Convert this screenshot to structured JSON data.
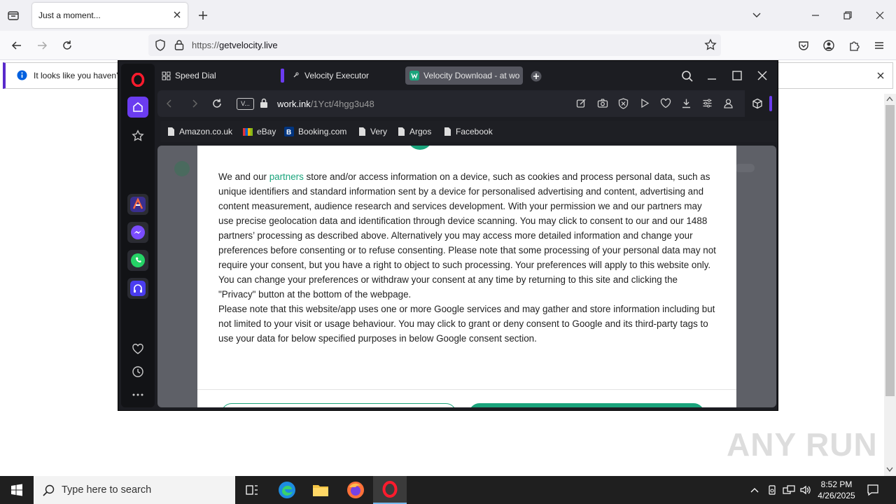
{
  "firefox": {
    "tab_title": "Just a moment...",
    "url_prefix": "https://",
    "url_host": "getvelocity.live",
    "notification_text": "It looks like you haven't"
  },
  "opera": {
    "tabs": [
      {
        "label": "Speed Dial"
      },
      {
        "label": "Velocity Executor"
      },
      {
        "label": "Velocity Download - at wo"
      }
    ],
    "vpn_label": "V...",
    "address_host": "work.ink",
    "address_path": "/1Yct/4hgg3u48",
    "bookmarks": [
      "Amazon.co.uk",
      "eBay",
      "Booking.com",
      "Very",
      "Argos",
      "Facebook"
    ]
  },
  "consent": {
    "p1_start": "We and our ",
    "partners_link": "partners",
    "p1_rest": " store and/or access information on a device, such as cookies and process personal data, such as unique identifiers and standard information sent by a device for personalised advertising and content, advertising and content measurement, audience research and services development. With your permission we and our partners may use precise geolocation data and identification through device scanning. You may click to consent to our and our 1488 partners’ processing as described above. Alternatively you may access more detailed information and change your preferences before consenting or to refuse consenting. Please note that some processing of your personal data may not require your consent, but you have a right to object to such processing. Your preferences will apply to this website only. You can change your preferences or withdraw your consent at any time by returning to this site and clicking the \"Privacy\" button at the bottom of the webpage.",
    "p2": "Please note that this website/app uses one or more Google services and may gather and store information including but not limited to your visit or usage behaviour. You may click to grant or deny consent to Google and its third-party tags to use your data for below specified purposes in below Google consent section."
  },
  "taskbar": {
    "search_placeholder": "Type here to search",
    "time": "8:52 PM",
    "date": "4/26/2025"
  },
  "watermark": "ANY RUN",
  "colors": {
    "accent_green": "#1aa47c",
    "opera_purple": "#6b3cf0",
    "opera_red": "#ff1b2d"
  }
}
